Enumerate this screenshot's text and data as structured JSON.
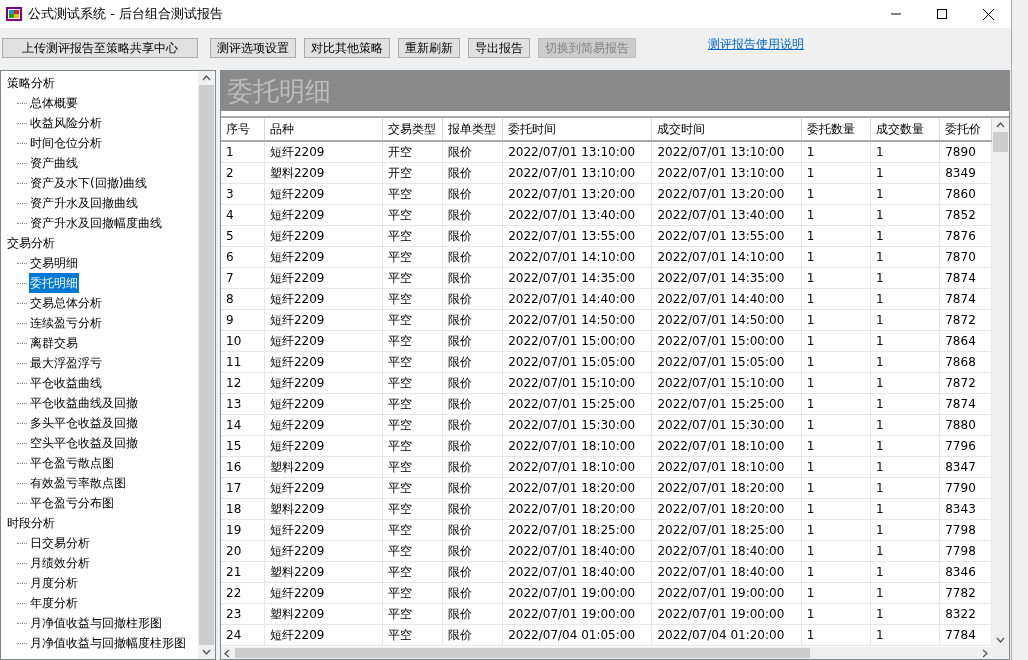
{
  "window": {
    "title": "公式测试系统 - 后台组合测试报告"
  },
  "toolbar": {
    "buttons": [
      {
        "label": "上传测评报告至策略共享中心",
        "disabled": false
      },
      {
        "label": "测评选项设置",
        "disabled": false
      },
      {
        "label": "对比其他策略",
        "disabled": false
      },
      {
        "label": "重新刷新",
        "disabled": false
      },
      {
        "label": "导出报告",
        "disabled": false
      },
      {
        "label": "切换到简易报告",
        "disabled": true
      }
    ],
    "link": "测评报告使用说明"
  },
  "sidebar": {
    "groups": [
      {
        "label": "策略分析",
        "children": [
          {
            "label": "总体概要",
            "selected": false
          },
          {
            "label": "收益风险分析",
            "selected": false
          },
          {
            "label": "时间仓位分析",
            "selected": false
          },
          {
            "label": "资产曲线",
            "selected": false
          },
          {
            "label": "资产及水下(回撤)曲线",
            "selected": false
          },
          {
            "label": "资产升水及回撤曲线",
            "selected": false
          },
          {
            "label": "资产升水及回撤幅度曲线",
            "selected": false
          }
        ]
      },
      {
        "label": "交易分析",
        "children": [
          {
            "label": "交易明细",
            "selected": false
          },
          {
            "label": "委托明细",
            "selected": true
          },
          {
            "label": "交易总体分析",
            "selected": false
          },
          {
            "label": "连续盈亏分析",
            "selected": false
          },
          {
            "label": "离群交易",
            "selected": false
          },
          {
            "label": "最大浮盈浮亏",
            "selected": false
          },
          {
            "label": "平仓收益曲线",
            "selected": false
          },
          {
            "label": "平仓收益曲线及回撤",
            "selected": false
          },
          {
            "label": "多头平仓收益及回撤",
            "selected": false
          },
          {
            "label": "空头平仓收益及回撤",
            "selected": false
          },
          {
            "label": "平仓盈亏散点图",
            "selected": false
          },
          {
            "label": "有效盈亏率散点图",
            "selected": false
          },
          {
            "label": "平仓盈亏分布图",
            "selected": false
          }
        ]
      },
      {
        "label": "时段分析",
        "children": [
          {
            "label": "日交易分析",
            "selected": false
          },
          {
            "label": "月绩效分析",
            "selected": false
          },
          {
            "label": "月度分析",
            "selected": false
          },
          {
            "label": "年度分析",
            "selected": false
          },
          {
            "label": "月净值收益与回撤柱形图",
            "selected": false
          },
          {
            "label": "月净值收益与回撤幅度柱形图",
            "selected": false
          }
        ]
      }
    ]
  },
  "panel": {
    "title": "委托明细"
  },
  "table": {
    "columns": [
      "序号",
      "品种",
      "交易类型",
      "报单类型",
      "委托时间",
      "成交时间",
      "委托数量",
      "成交数量",
      "委托价"
    ],
    "rows": [
      [
        "1",
        "短纤2209",
        "开空",
        "限价",
        "2022/07/01 13:10:00",
        "2022/07/01 13:10:00",
        "1",
        "1",
        "7890"
      ],
      [
        "2",
        "塑料2209",
        "开空",
        "限价",
        "2022/07/01 13:10:00",
        "2022/07/01 13:10:00",
        "1",
        "1",
        "8349"
      ],
      [
        "3",
        "短纤2209",
        "平空",
        "限价",
        "2022/07/01 13:20:00",
        "2022/07/01 13:20:00",
        "1",
        "1",
        "7860"
      ],
      [
        "4",
        "短纤2209",
        "平空",
        "限价",
        "2022/07/01 13:40:00",
        "2022/07/01 13:40:00",
        "1",
        "1",
        "7852"
      ],
      [
        "5",
        "短纤2209",
        "平空",
        "限价",
        "2022/07/01 13:55:00",
        "2022/07/01 13:55:00",
        "1",
        "1",
        "7876"
      ],
      [
        "6",
        "短纤2209",
        "平空",
        "限价",
        "2022/07/01 14:10:00",
        "2022/07/01 14:10:00",
        "1",
        "1",
        "7870"
      ],
      [
        "7",
        "短纤2209",
        "平空",
        "限价",
        "2022/07/01 14:35:00",
        "2022/07/01 14:35:00",
        "1",
        "1",
        "7874"
      ],
      [
        "8",
        "短纤2209",
        "平空",
        "限价",
        "2022/07/01 14:40:00",
        "2022/07/01 14:40:00",
        "1",
        "1",
        "7874"
      ],
      [
        "9",
        "短纤2209",
        "平空",
        "限价",
        "2022/07/01 14:50:00",
        "2022/07/01 14:50:00",
        "1",
        "1",
        "7872"
      ],
      [
        "10",
        "短纤2209",
        "平空",
        "限价",
        "2022/07/01 15:00:00",
        "2022/07/01 15:00:00",
        "1",
        "1",
        "7864"
      ],
      [
        "11",
        "短纤2209",
        "平空",
        "限价",
        "2022/07/01 15:05:00",
        "2022/07/01 15:05:00",
        "1",
        "1",
        "7868"
      ],
      [
        "12",
        "短纤2209",
        "平空",
        "限价",
        "2022/07/01 15:10:00",
        "2022/07/01 15:10:00",
        "1",
        "1",
        "7872"
      ],
      [
        "13",
        "短纤2209",
        "平空",
        "限价",
        "2022/07/01 15:25:00",
        "2022/07/01 15:25:00",
        "1",
        "1",
        "7874"
      ],
      [
        "14",
        "短纤2209",
        "平空",
        "限价",
        "2022/07/01 15:30:00",
        "2022/07/01 15:30:00",
        "1",
        "1",
        "7880"
      ],
      [
        "15",
        "短纤2209",
        "平空",
        "限价",
        "2022/07/01 18:10:00",
        "2022/07/01 18:10:00",
        "1",
        "1",
        "7796"
      ],
      [
        "16",
        "塑料2209",
        "平空",
        "限价",
        "2022/07/01 18:10:00",
        "2022/07/01 18:10:00",
        "1",
        "1",
        "8347"
      ],
      [
        "17",
        "短纤2209",
        "平空",
        "限价",
        "2022/07/01 18:20:00",
        "2022/07/01 18:20:00",
        "1",
        "1",
        "7790"
      ],
      [
        "18",
        "塑料2209",
        "平空",
        "限价",
        "2022/07/01 18:20:00",
        "2022/07/01 18:20:00",
        "1",
        "1",
        "8343"
      ],
      [
        "19",
        "短纤2209",
        "平空",
        "限价",
        "2022/07/01 18:25:00",
        "2022/07/01 18:25:00",
        "1",
        "1",
        "7798"
      ],
      [
        "20",
        "短纤2209",
        "平空",
        "限价",
        "2022/07/01 18:40:00",
        "2022/07/01 18:40:00",
        "1",
        "1",
        "7798"
      ],
      [
        "21",
        "塑料2209",
        "平空",
        "限价",
        "2022/07/01 18:40:00",
        "2022/07/01 18:40:00",
        "1",
        "1",
        "8346"
      ],
      [
        "22",
        "短纤2209",
        "平空",
        "限价",
        "2022/07/01 19:00:00",
        "2022/07/01 19:00:00",
        "1",
        "1",
        "7782"
      ],
      [
        "23",
        "塑料2209",
        "平空",
        "限价",
        "2022/07/01 19:00:00",
        "2022/07/01 19:00:00",
        "1",
        "1",
        "8322"
      ],
      [
        "24",
        "短纤2209",
        "平空",
        "限价",
        "2022/07/04 01:05:00",
        "2022/07/04 01:20:00",
        "1",
        "1",
        "7784"
      ]
    ]
  }
}
